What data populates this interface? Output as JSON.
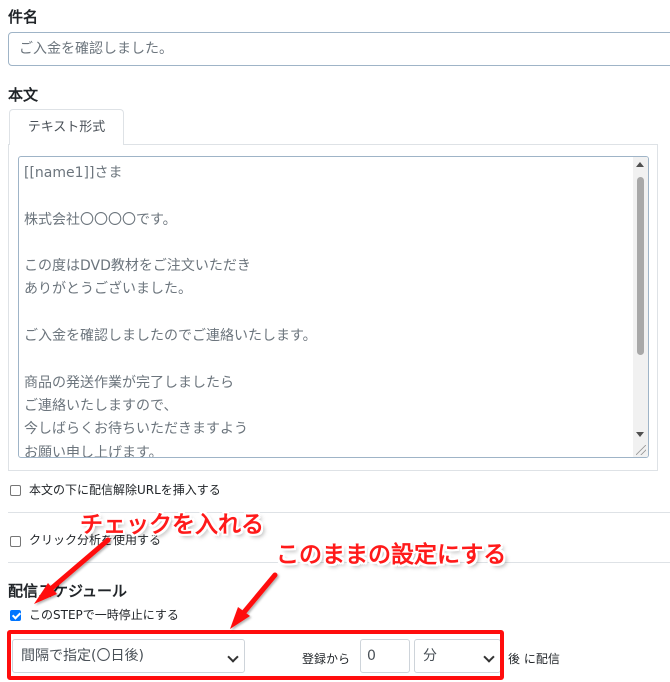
{
  "subject": {
    "label": "件名",
    "value": "ご入金を確認しました。"
  },
  "body": {
    "label": "本文",
    "tab_label": "テキスト形式",
    "text": "[[name1]]さま\n\n株式会社〇〇〇〇です。\n\nこの度はDVD教材をご注文いただき\nありがとうございました。\n\nご入金を確認しましたのでご連絡いたします。\n\n商品の発送作業が完了しましたら\nご連絡いたしますので、\n今しばらくお待ちいただきますよう\nお願い申し上げます。"
  },
  "options": {
    "unsubscribe_label": "本文の下に配信解除URLを挿入する",
    "unsubscribe_checked": false,
    "click_analysis_label": "クリック分析を使用する",
    "click_analysis_checked": false
  },
  "schedule": {
    "heading": "配信スケジュール",
    "pause_label": "このSTEPで一時停止にする",
    "pause_checked": true,
    "interval_select": "間隔で指定(〇日後)",
    "from_registration_label": "登録から",
    "number_value": "0",
    "unit_select": "分",
    "after_deliver_label": "後 に配信"
  },
  "annotations": {
    "check_callout": "チェックを入れる",
    "keep_settings_callout": "このままの設定にする",
    "accent_color": "#ff1a1a"
  }
}
